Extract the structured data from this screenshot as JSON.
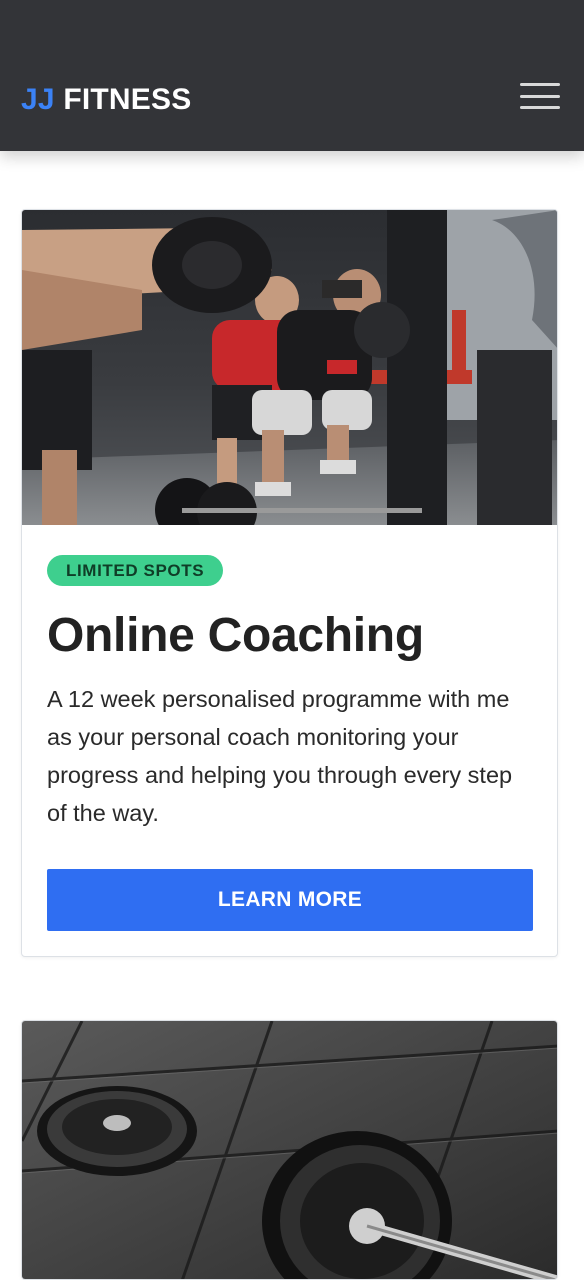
{
  "header": {
    "brand_accent": "JJ",
    "brand_rest": "FITNESS",
    "colors": {
      "background": "#333438",
      "accent": "#3b82f6",
      "text": "#ffffff"
    },
    "menu_icon": "hamburger-menu-icon"
  },
  "cards": [
    {
      "image_subject": "gym-weightlifting-coach-photo",
      "badge": "LIMITED SPOTS",
      "badge_color": "#3ecf8e",
      "title": "Online Coaching",
      "description": "A 12 week personalised programme with me as your personal coach monitoring your progress and helping you through every step of the way.",
      "button_label": "LEARN MORE",
      "button_color": "#2f6ef2"
    },
    {
      "image_subject": "barbell-on-gym-floor-photo"
    }
  ]
}
